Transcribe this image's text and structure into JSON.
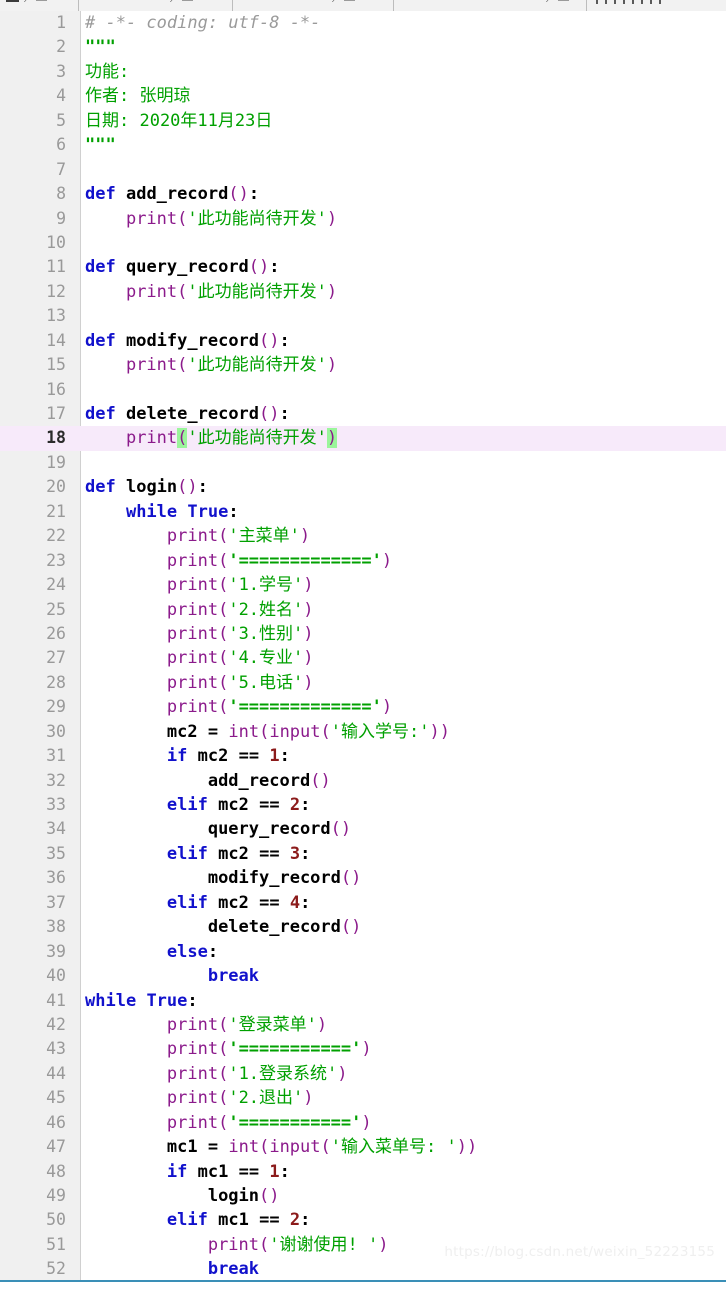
{
  "app": {
    "kind": "python-code-editor",
    "watermark": "https://blog.csdn.net/weixin_52223155"
  },
  "toolbar": {
    "groups": [
      {
        "name": "file-group",
        "glyphs": [
          "bar-icon",
          "pencil-icon",
          "dash-icon"
        ]
      },
      {
        "name": "edit-group",
        "glyphs": [
          "pencil-icon",
          "dash-icon"
        ]
      },
      {
        "name": "view-group",
        "glyphs": [
          "pencil-icon",
          "dash-icon"
        ]
      },
      {
        "name": "run-group",
        "glyphs": [
          "pencil-icon",
          "dash-icon"
        ]
      },
      {
        "name": "tools-group",
        "glyphs": [
          "ticks-icon"
        ]
      }
    ]
  },
  "editor": {
    "gutter_width": 80,
    "highlight_line": 18,
    "colors": {
      "background": "#ffffff",
      "gutter": "#f0f0f0",
      "line_number": "#999999",
      "current_line": "#f7eafa",
      "bracket_match": "#9bf59b",
      "comment": "#9a9a9a",
      "keyword": "#1111cc",
      "builtin": "#8b1a8b",
      "string": "#00a000",
      "number": "#8b1a1a",
      "text": "#000000",
      "bottom_rule": "#3a8fb7"
    },
    "lines": [
      {
        "n": 1,
        "text": "# -*- coding: utf-8 -*-"
      },
      {
        "n": 2,
        "text": "\"\"\""
      },
      {
        "n": 3,
        "text": "功能:"
      },
      {
        "n": 4,
        "text": "作者: 张明琼"
      },
      {
        "n": 5,
        "text": "日期: 2020年11月23日"
      },
      {
        "n": 6,
        "text": "\"\"\""
      },
      {
        "n": 7,
        "text": ""
      },
      {
        "n": 8,
        "text": "def add_record():"
      },
      {
        "n": 9,
        "text": "    print('此功能尚待开发')"
      },
      {
        "n": 10,
        "text": ""
      },
      {
        "n": 11,
        "text": "def query_record():"
      },
      {
        "n": 12,
        "text": "    print('此功能尚待开发')"
      },
      {
        "n": 13,
        "text": ""
      },
      {
        "n": 14,
        "text": "def modify_record():"
      },
      {
        "n": 15,
        "text": "    print('此功能尚待开发')"
      },
      {
        "n": 16,
        "text": ""
      },
      {
        "n": 17,
        "text": "def delete_record():"
      },
      {
        "n": 18,
        "text": "    print('此功能尚待开发')"
      },
      {
        "n": 19,
        "text": ""
      },
      {
        "n": 20,
        "text": "def login():"
      },
      {
        "n": 21,
        "text": "    while True:"
      },
      {
        "n": 22,
        "text": "        print('主菜单')"
      },
      {
        "n": 23,
        "text": "        print('=============')"
      },
      {
        "n": 24,
        "text": "        print('1.学号')"
      },
      {
        "n": 25,
        "text": "        print('2.姓名')"
      },
      {
        "n": 26,
        "text": "        print('3.性别')"
      },
      {
        "n": 27,
        "text": "        print('4.专业')"
      },
      {
        "n": 28,
        "text": "        print('5.电话')"
      },
      {
        "n": 29,
        "text": "        print('=============')"
      },
      {
        "n": 30,
        "text": "        mc2 = int(input('输入学号:'))"
      },
      {
        "n": 31,
        "text": "        if mc2 == 1:"
      },
      {
        "n": 32,
        "text": "            add_record()"
      },
      {
        "n": 33,
        "text": "        elif mc2 == 2:"
      },
      {
        "n": 34,
        "text": "            query_record()"
      },
      {
        "n": 35,
        "text": "        elif mc2 == 3:"
      },
      {
        "n": 36,
        "text": "            modify_record()"
      },
      {
        "n": 37,
        "text": "        elif mc2 == 4:"
      },
      {
        "n": 38,
        "text": "            delete_record()"
      },
      {
        "n": 39,
        "text": "        else:"
      },
      {
        "n": 40,
        "text": "            break"
      },
      {
        "n": 41,
        "text": "while True:"
      },
      {
        "n": 42,
        "text": "        print('登录菜单')"
      },
      {
        "n": 43,
        "text": "        print('===========')"
      },
      {
        "n": 44,
        "text": "        print('1.登录系统')"
      },
      {
        "n": 45,
        "text": "        print('2.退出')"
      },
      {
        "n": 46,
        "text": "        print('===========')"
      },
      {
        "n": 47,
        "text": "        mc1 = int(input('输入菜单号: '))"
      },
      {
        "n": 48,
        "text": "        if mc1 == 1:"
      },
      {
        "n": 49,
        "text": "            login()"
      },
      {
        "n": 50,
        "text": "        elif mc1 == 2:"
      },
      {
        "n": 51,
        "text": "            print('谢谢使用! ')"
      },
      {
        "n": 52,
        "text": "            break"
      }
    ],
    "line_numbers": [
      "1",
      "2",
      "3",
      "4",
      "5",
      "6",
      "7",
      "8",
      "9",
      "10",
      "11",
      "12",
      "13",
      "14",
      "15",
      "16",
      "17",
      "18",
      "19",
      "20",
      "21",
      "22",
      "23",
      "24",
      "25",
      "26",
      "27",
      "28",
      "29",
      "30",
      "31",
      "32",
      "33",
      "34",
      "35",
      "36",
      "37",
      "38",
      "39",
      "40",
      "41",
      "42",
      "43",
      "44",
      "45",
      "46",
      "47",
      "48",
      "49",
      "50",
      "51",
      "52"
    ]
  }
}
